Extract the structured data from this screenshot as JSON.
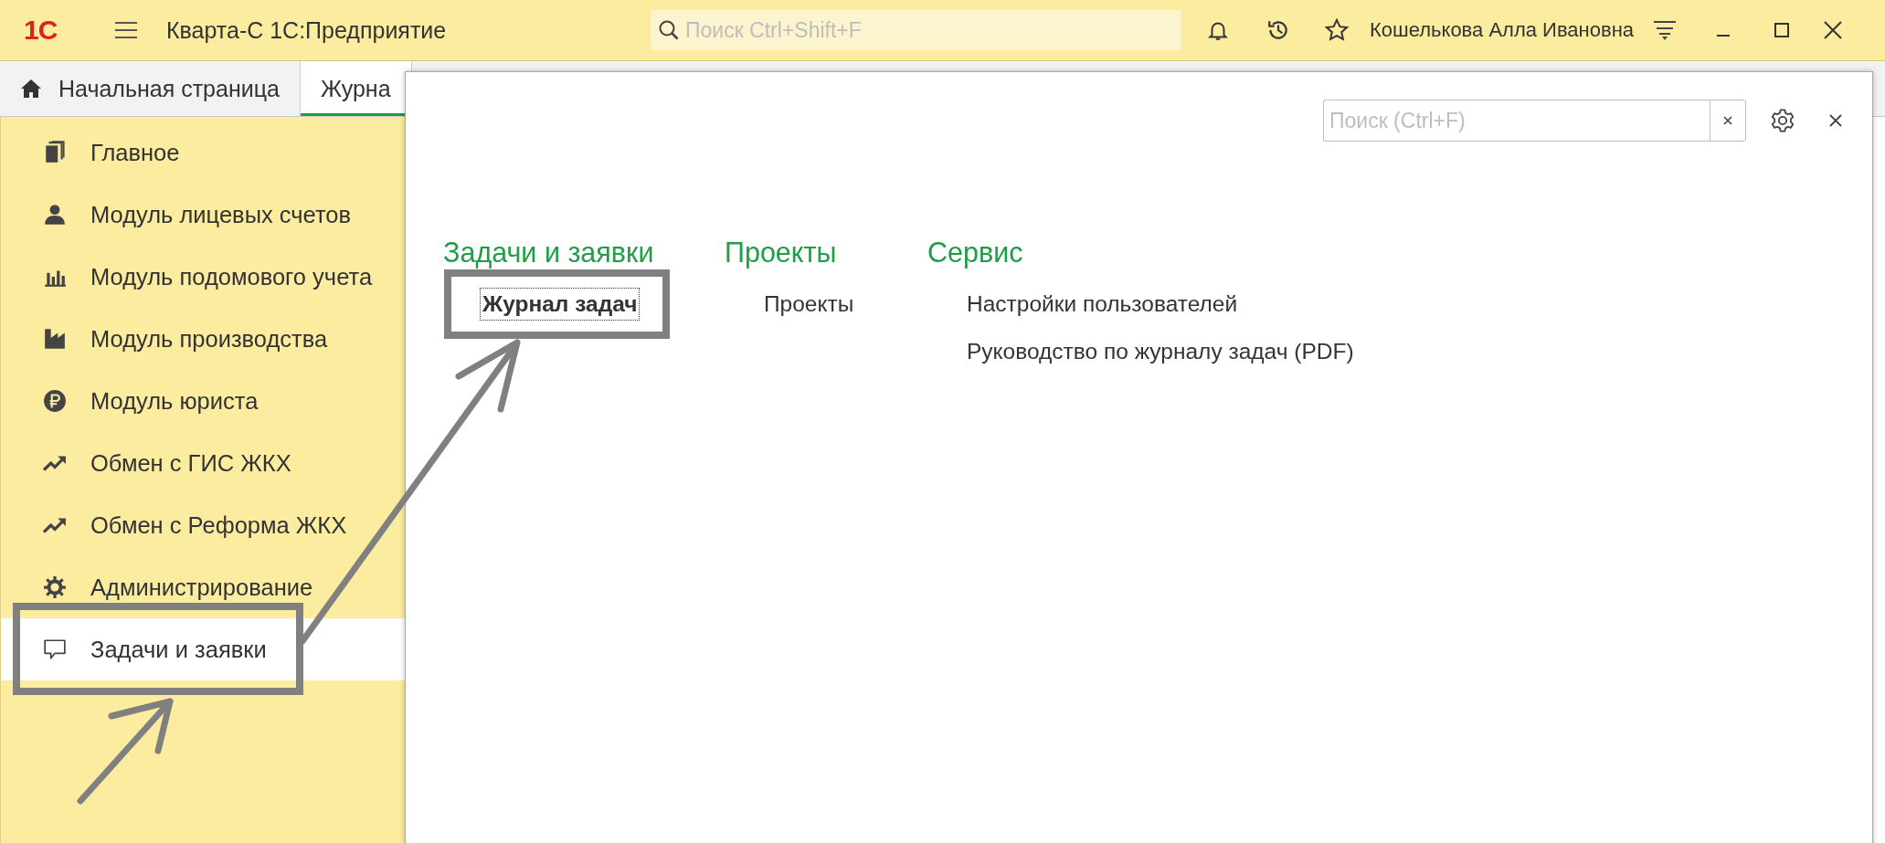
{
  "window": {
    "logo": "1С",
    "title": "Кварта-С 1С:Предприятие",
    "search": {
      "placeholder": "Поиск Ctrl+Shift+F"
    },
    "user": "Кошелькова Алла Ивановна"
  },
  "tabs": [
    {
      "label": "Начальная страница",
      "kind": "home",
      "selected": false
    },
    {
      "label": "Журна",
      "kind": "page",
      "selected": true
    }
  ],
  "sidebar": {
    "items": [
      {
        "label": "Главное",
        "selected": false
      },
      {
        "label": "Модуль лицевых счетов",
        "selected": false
      },
      {
        "label": "Модуль подомового учета",
        "selected": false
      },
      {
        "label": "Модуль производства",
        "selected": false
      },
      {
        "label": "Модуль юриста",
        "selected": false
      },
      {
        "label": "Обмен с ГИС ЖКХ",
        "selected": false
      },
      {
        "label": "Обмен с Реформа ЖКХ",
        "selected": false
      },
      {
        "label": "Администрирование",
        "selected": false
      },
      {
        "label": "Задачи и заявки",
        "selected": true
      }
    ]
  },
  "panel": {
    "search": {
      "placeholder": "Поиск (Ctrl+F)"
    },
    "sections": [
      {
        "title": "Задачи и заявки",
        "items": [
          {
            "label": "Журнал задач",
            "selected": true
          }
        ]
      },
      {
        "title": "Проекты",
        "items": [
          {
            "label": "Проекты",
            "selected": false
          }
        ]
      },
      {
        "title": "Сервис",
        "items": [
          {
            "label": "Настройки пользователей",
            "selected": false
          },
          {
            "label": "Руководство по журналу задач (PDF)",
            "selected": false
          }
        ]
      }
    ]
  }
}
